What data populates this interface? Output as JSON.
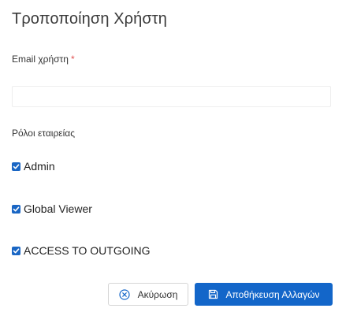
{
  "dialog": {
    "title": "Τροποποίηση Χρήστη"
  },
  "email": {
    "label": "Email χρήστη",
    "required_mark": "*",
    "value": ""
  },
  "roles": {
    "label": "Ρόλοι εταιρείας",
    "items": [
      {
        "label": "Admin",
        "checked": true
      },
      {
        "label": "Global Viewer",
        "checked": true
      },
      {
        "label": "ACCESS TO OUTGOING",
        "checked": true
      }
    ]
  },
  "actions": {
    "cancel_label": "Ακύρωση",
    "cancel_icon": "close-circle-icon",
    "save_label": "Αποθήκευση Αλλαγών",
    "save_icon": "save-icon"
  },
  "colors": {
    "primary": "#1366c9",
    "required": "#e05252"
  }
}
